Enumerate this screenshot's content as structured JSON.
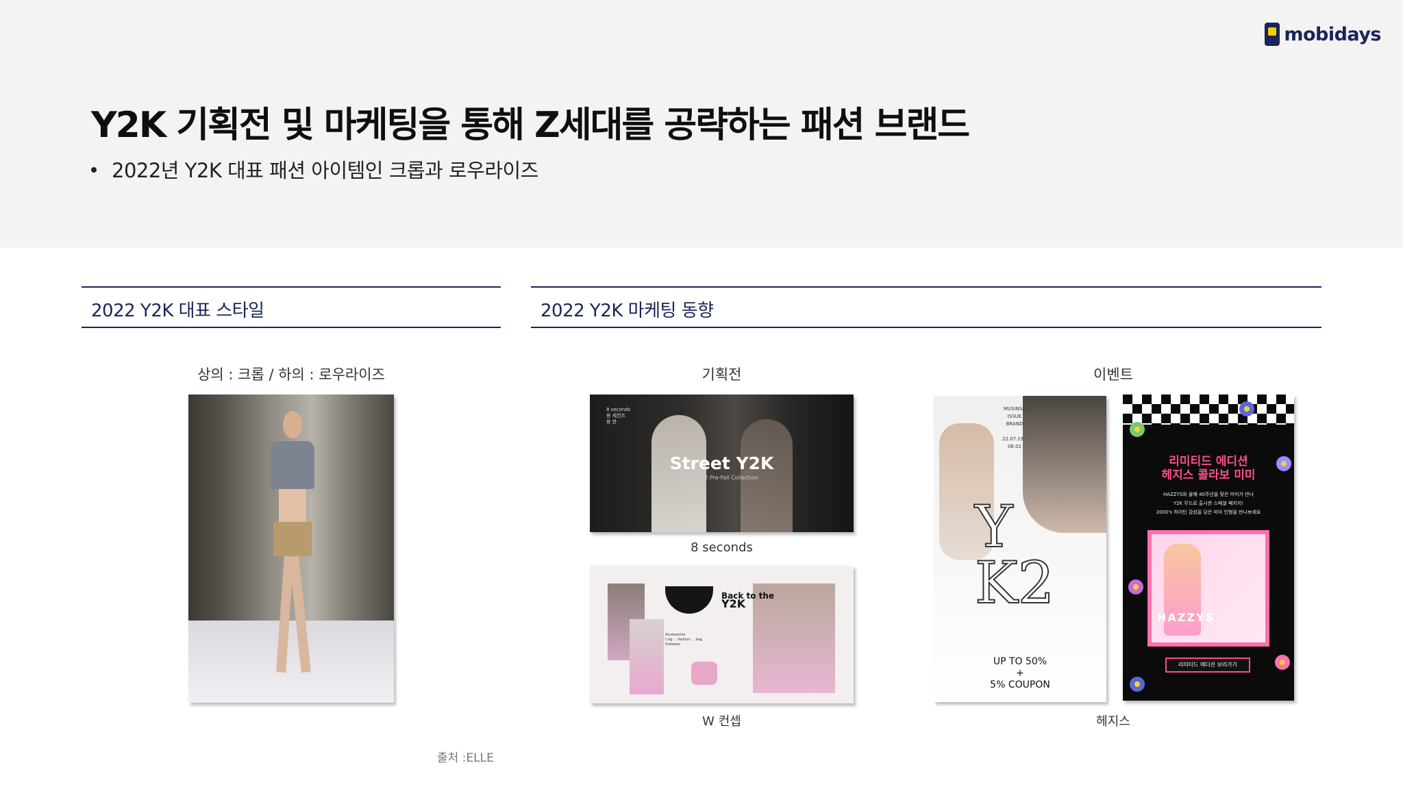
{
  "logo": {
    "text": "mobidays",
    "mark": "mobidays-logo-icon"
  },
  "header": {
    "title": "Y2K 기획전 및 마케팅을 통해 Z세대를 공략하는 패션 브랜드",
    "bullet": "2022년 Y2K 대표 패션 아이템인 크롭과 로우라이즈"
  },
  "sections": {
    "style": {
      "title": "2022 Y2K 대표 스타일",
      "caption": "상의 : 크롭  / 하의 : 로우라이즈"
    },
    "marketing": {
      "title": "2022 Y2K 마케팅 동향",
      "exhibition_label": "기획전",
      "event_label": "이벤트",
      "eight_seconds_caption": "8 seconds",
      "wconcept_caption": "W 컨셉",
      "hazzys_caption": "헤지스"
    }
  },
  "images": {
    "eight_seconds": {
      "brand": "8 seconds\n용 세컨즈\n용 한",
      "headline": "Street Y2K",
      "sub": "8S 2022 Pre-Fall Collection"
    },
    "wconcept": {
      "headline1": "Back to the",
      "headline2": "Y2K",
      "tiny": "Accessories\nL'eg ... fashion ... bag\nfootwear"
    },
    "musinsa": {
      "header": "MUSINSA\nISSUE\nBRAND\n\n22.07.19 -\n08.02",
      "art": "Y\nK2",
      "coupon": "UP TO 50%\n+\n5% COUPON"
    },
    "hazzys": {
      "headline": "리미티드 에디션\n헤지스 콜라보 미미",
      "desc": "HAZZYS와 올해 40주년을 맞은 미미가 만나\nY2K 무드로 출시한 스페셜 패키지!\n2000's 하이틴 감성을 담은 미미 인형을 만나보세요",
      "doll_logo": "HAZZYS",
      "button": "리미티드 에디션 보러가기"
    }
  },
  "source": "출처 :ELLE",
  "colors": {
    "navy": "#1a2459",
    "header_bg": "#f3f3f3",
    "accent_yellow": "#f4d000",
    "hazzys_pink": "#ff4d8d"
  }
}
